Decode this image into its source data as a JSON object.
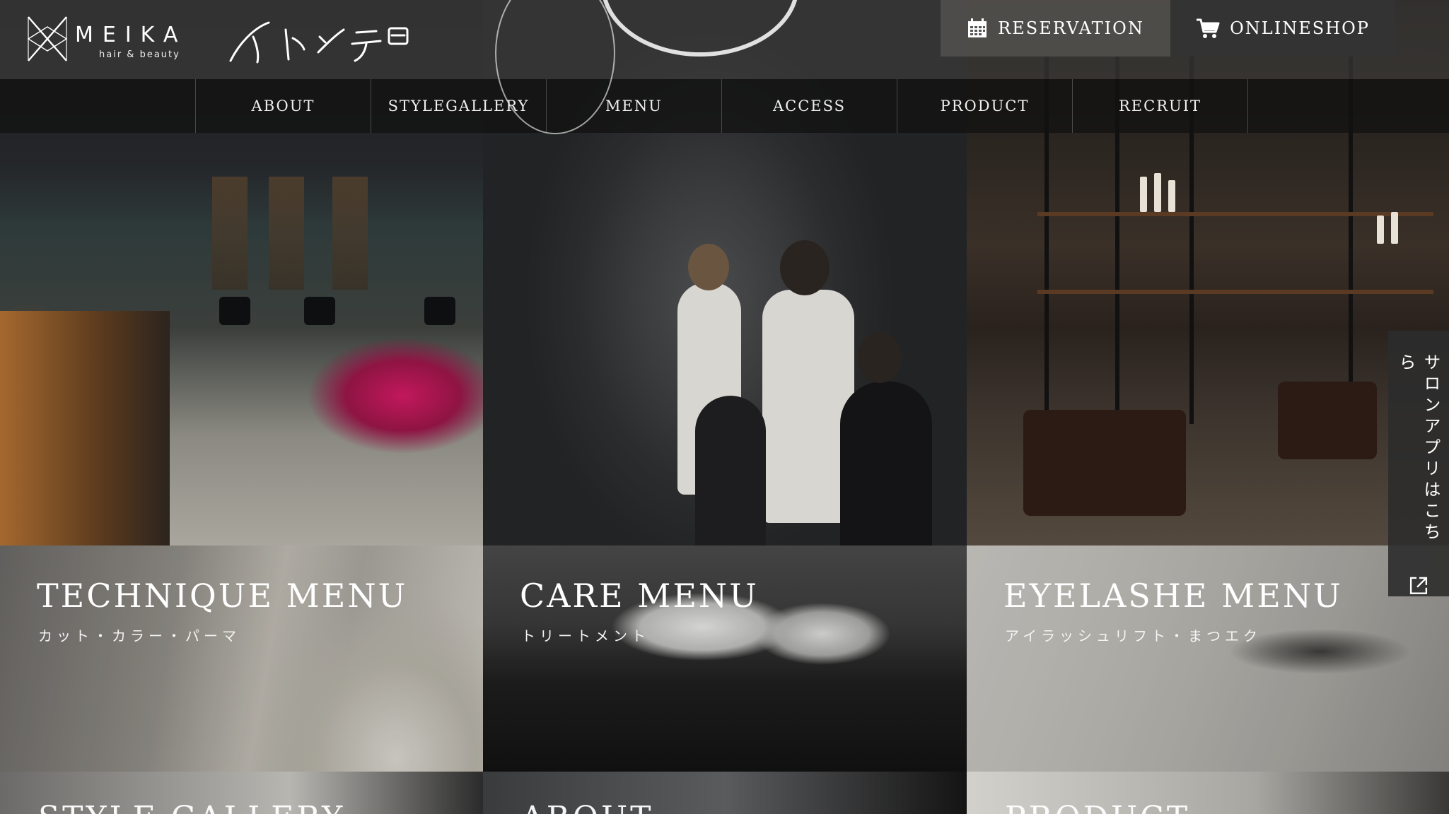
{
  "header": {
    "logo_name": "MEIKA",
    "logo_tagline": "hair & beauty",
    "reservation_label": "RESERVATION",
    "shop_label": "ONLINESHOP"
  },
  "nav": [
    "ABOUT",
    "STYLEGALLERY",
    "MENU",
    "ACCESS",
    "PRODUCT",
    "RECRUIT"
  ],
  "menu_tiles": [
    {
      "title": "TECHNIQUE MENU",
      "subtitle": "カット・カラー・パーマ"
    },
    {
      "title": "CARE MENU",
      "subtitle": "トリートメント"
    },
    {
      "title": "EYELASHE MENU",
      "subtitle": "アイラッシュリフト・まつエク"
    }
  ],
  "bottom_tiles": [
    "STYLE GALLERY",
    "ABOUT",
    "PRODUCT"
  ],
  "side_tab": {
    "label": "サロンアプリはこちら"
  },
  "icons": [
    "logo-mark",
    "calendar-icon",
    "cart-icon",
    "external-link-icon"
  ]
}
